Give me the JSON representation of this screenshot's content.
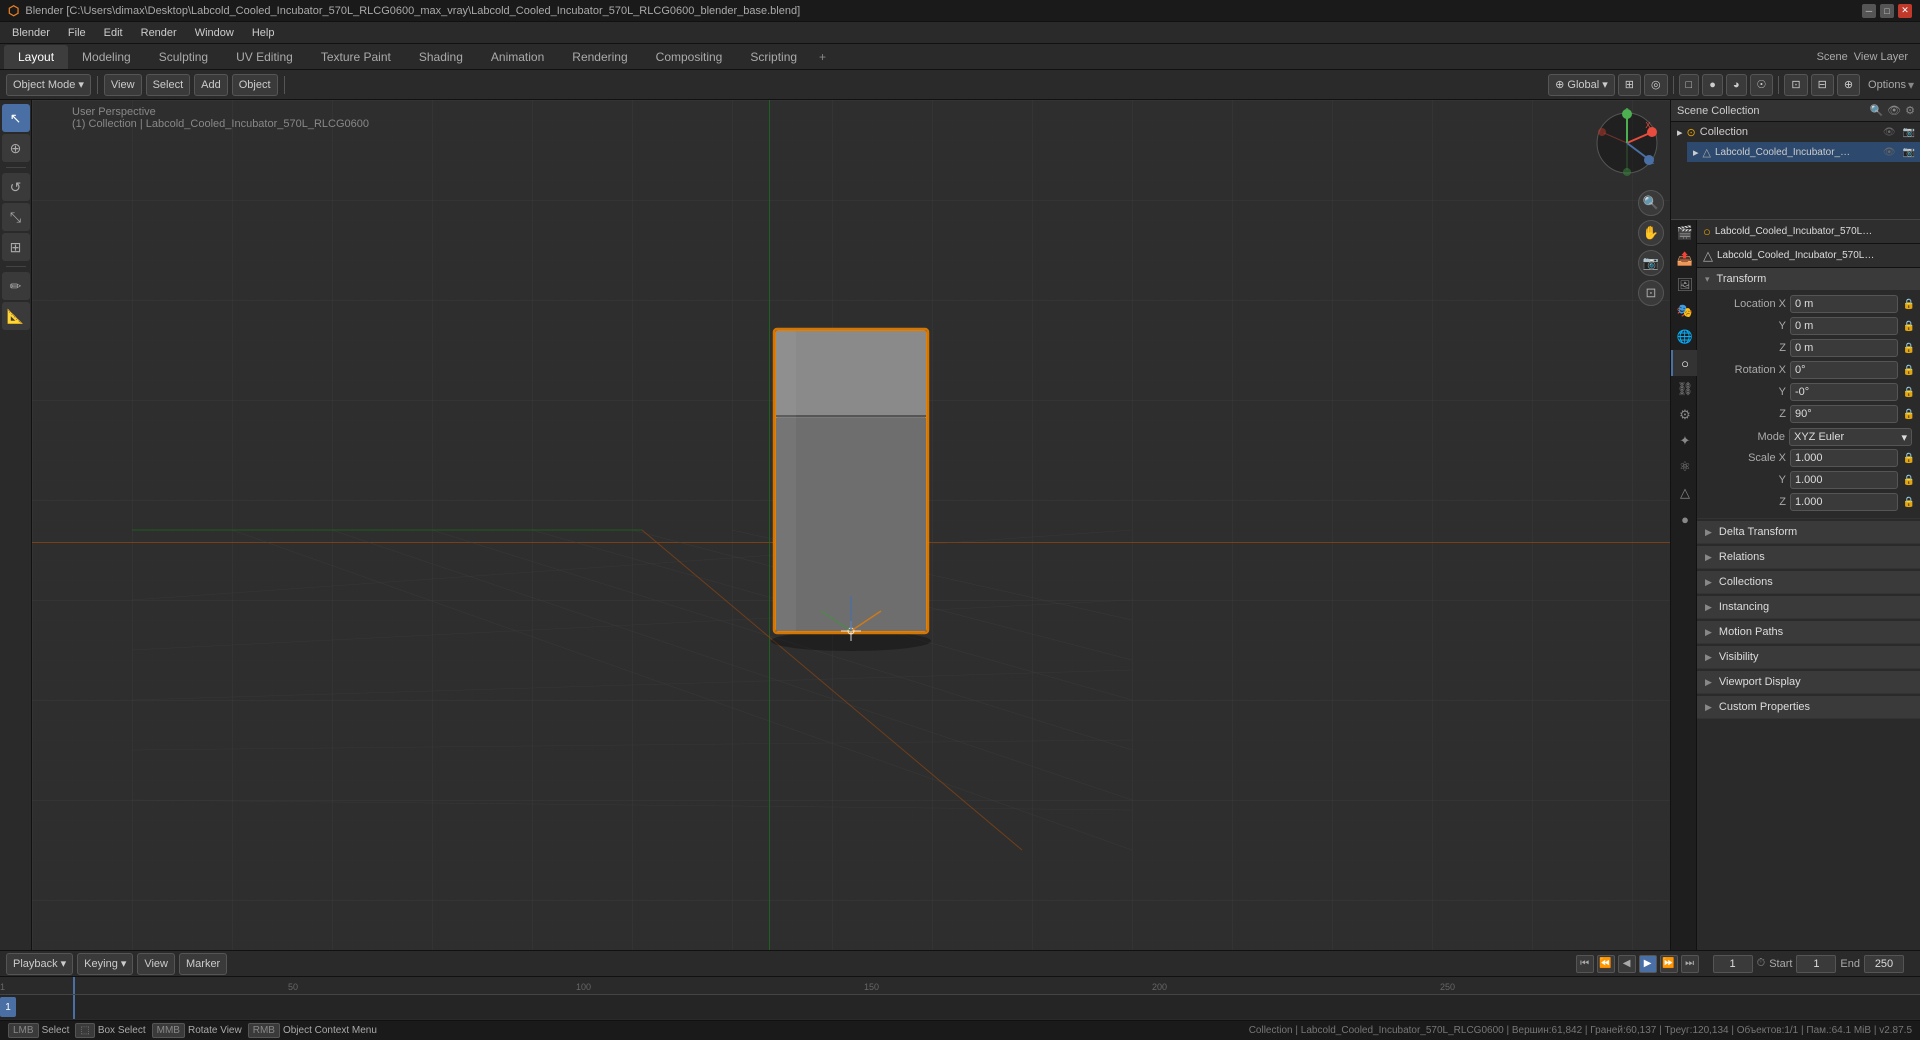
{
  "titleBar": {
    "title": "Blender [C:\\Users\\dimax\\Desktop\\Labcold_Cooled_Incubator_570L_RLCG0600_max_vray\\Labcold_Cooled_Incubator_570L_RLCG0600_blender_base.blend]",
    "controls": [
      "_",
      "□",
      "✕"
    ]
  },
  "menuBar": {
    "items": [
      "Blender",
      "File",
      "Edit",
      "Render",
      "Window",
      "Help"
    ]
  },
  "topTabs": {
    "items": [
      "Layout",
      "Modeling",
      "Sculpting",
      "UV Editing",
      "Texture Paint",
      "Shading",
      "Animation",
      "Rendering",
      "Compositing",
      "Scripting"
    ],
    "activeTab": "Layout",
    "plusLabel": "+"
  },
  "viewportToolbar": {
    "modeLabel": "Object Mode",
    "viewLabel": "View",
    "selectLabel": "Select",
    "addLabel": "Add",
    "objectLabel": "Object",
    "globalLabel": "Global",
    "icons": [
      "cursor",
      "move",
      "rotate",
      "scale"
    ]
  },
  "viewportInfo": {
    "line1": "User Perspective",
    "line2": "(1) Collection | Labcold_Cooled_Incubator_570L_RLCG0600"
  },
  "viewport": {
    "perspective": "User Perspective",
    "collection": "(1) Collection | Labcold_Cooled_Incubator_570L_RLCG0600"
  },
  "outliner": {
    "title": "Scene Collection",
    "items": [
      {
        "label": "Collection",
        "icon": "▸",
        "indent": 0,
        "selected": false
      },
      {
        "label": "Labcold_Cooled_Incubator_570L_RLCG0600",
        "icon": "▸",
        "indent": 1,
        "selected": true
      }
    ]
  },
  "properties": {
    "objectName": "Labcold_Cooled_Incubator_570L_RLCG0600",
    "meshName": "Labcold_Cooled_Incubator_570L_RLCG0600",
    "transform": {
      "label": "Transform",
      "locationX": "0 m",
      "locationY": "0 m",
      "locationZ": "0 m",
      "rotationX": "0°",
      "rotationY": "-0°",
      "rotationZ": "90°",
      "mode": "XYZ Euler",
      "scaleX": "1.000",
      "scaleY": "1.000",
      "scaleZ": "1.000"
    },
    "sections": [
      {
        "label": "Delta Transform",
        "collapsed": true
      },
      {
        "label": "Relations",
        "collapsed": true
      },
      {
        "label": "Collections",
        "collapsed": true
      },
      {
        "label": "Instancing",
        "collapsed": true
      },
      {
        "label": "Motion Paths",
        "collapsed": true
      },
      {
        "label": "Visibility",
        "collapsed": true
      },
      {
        "label": "Viewport Display",
        "collapsed": true
      },
      {
        "label": "Custom Properties",
        "collapsed": true
      }
    ]
  },
  "timeline": {
    "playbackLabel": "Playback",
    "keyingLabel": "Keying",
    "viewLabel": "View",
    "markerLabel": "Marker",
    "currentFrame": "1",
    "startFrame": "1",
    "endFrame": "250",
    "startLabel": "Start",
    "endLabel": "End",
    "rulerMarks": [
      "1",
      "50",
      "100",
      "150",
      "200",
      "250"
    ]
  },
  "statusBar": {
    "selectLabel": "Select",
    "boxSelectLabel": "Box Select",
    "rotateViewLabel": "Rotate View",
    "objectContextLabel": "Object Context Menu",
    "info": "Collection | Labcold_Cooled_Incubator_570L_RLCG0600 | Вершин:61,842 | Граней:60,137 | Треуг:120,134 | Объектов:1/1 | Пам.:64.1 MiB | v2.87.5"
  },
  "leftTools": [
    {
      "icon": "↖",
      "name": "cursor-tool",
      "active": false
    },
    {
      "icon": "↔",
      "name": "move-tool",
      "active": true
    },
    {
      "icon": "↺",
      "name": "rotate-tool",
      "active": false
    },
    {
      "icon": "⤡",
      "name": "scale-tool",
      "active": false
    },
    {
      "icon": "⊞",
      "name": "transform-tool",
      "active": false
    },
    {
      "icon": "✏",
      "name": "annotate-tool",
      "active": false
    },
    {
      "icon": "📏",
      "name": "measure-tool",
      "active": false
    }
  ],
  "icons": {
    "chevronRight": "▶",
    "chevronDown": "▾",
    "lock": "🔒",
    "eye": "👁",
    "camera": "📷",
    "render": "🎬",
    "object": "○",
    "mesh": "△",
    "material": "●",
    "particles": "✦",
    "physics": "⚙",
    "constraints": "⛓",
    "objectData": "△",
    "scene": "🎬",
    "world": "🌐"
  }
}
